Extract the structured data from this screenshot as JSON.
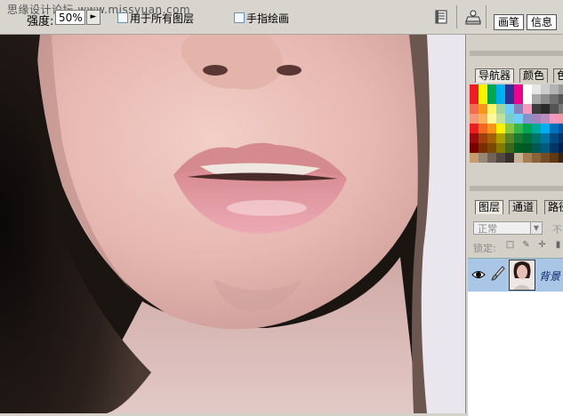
{
  "watermark": "思缘设计论坛 www.missyuan.com",
  "options_bar": {
    "strength_label": "强度:",
    "strength_value": "50%",
    "sample_all_layers_label": "用于所有图层",
    "finger_painting_label": "手指绘画",
    "tabs": [
      "画笔",
      "信息"
    ]
  },
  "palette_panel": {
    "tabs": [
      "导航器",
      "颜色",
      "色"
    ],
    "swatch_colors": [
      [
        "#ed1c24",
        "#fff200",
        "#00a651",
        "#00aeef",
        "#2e3192",
        "#ec008c",
        "#ffffff",
        "#e6e6e6",
        "#cccccc",
        "#b3b3b3",
        "#999999"
      ],
      [
        "#ed1c24",
        "#fff200",
        "#00a651",
        "#00aeef",
        "#2e3192",
        "#ec008c",
        "#ffffff",
        "#a8a8a8",
        "#8c8c8c",
        "#707070",
        "#555555"
      ],
      [
        "#f26c4f",
        "#f7941d",
        "#fff568",
        "#a3d39c",
        "#6dcff6",
        "#8781bd",
        "#f49ac1",
        "#3c3c3c",
        "#2a2a2a",
        "#555555",
        "#777777"
      ],
      [
        "#f7977a",
        "#fbaf5d",
        "#fff79a",
        "#c4df9b",
        "#7accc8",
        "#6dcff6",
        "#8393ca",
        "#a186be",
        "#bd8cbf",
        "#f49ac2",
        "#f6989d"
      ],
      [
        "#ed1c24",
        "#f26522",
        "#f7941d",
        "#fff200",
        "#8dc63f",
        "#39b54a",
        "#00a651",
        "#00a99d",
        "#00aeef",
        "#0072bc",
        "#0054a6"
      ],
      [
        "#9e0b0f",
        "#a0410d",
        "#a36209",
        "#aba000",
        "#598527",
        "#1a7b30",
        "#007236",
        "#00746b",
        "#0076a3",
        "#004a80",
        "#003471"
      ],
      [
        "#790000",
        "#7b2e00",
        "#7d4900",
        "#827b00",
        "#406618",
        "#005e20",
        "#005826",
        "#005952",
        "#005b7f",
        "#003663",
        "#002157"
      ],
      [
        "#c69c6d",
        "#998675",
        "#736357",
        "#534741",
        "#362f2d",
        "#c7b299",
        "#a67c52",
        "#8c6239",
        "#754c24",
        "#603913",
        "#3b2314"
      ]
    ]
  },
  "layers_panel": {
    "tabs": [
      "图层",
      "通道",
      "路径"
    ],
    "blend_mode": "正常",
    "opacity_label": "不",
    "lock_label": "锁定:",
    "layer_name": "背景"
  },
  "colors": {
    "layer_selected": "#a9c6e6",
    "panel_bg": "#d4d0c8"
  }
}
